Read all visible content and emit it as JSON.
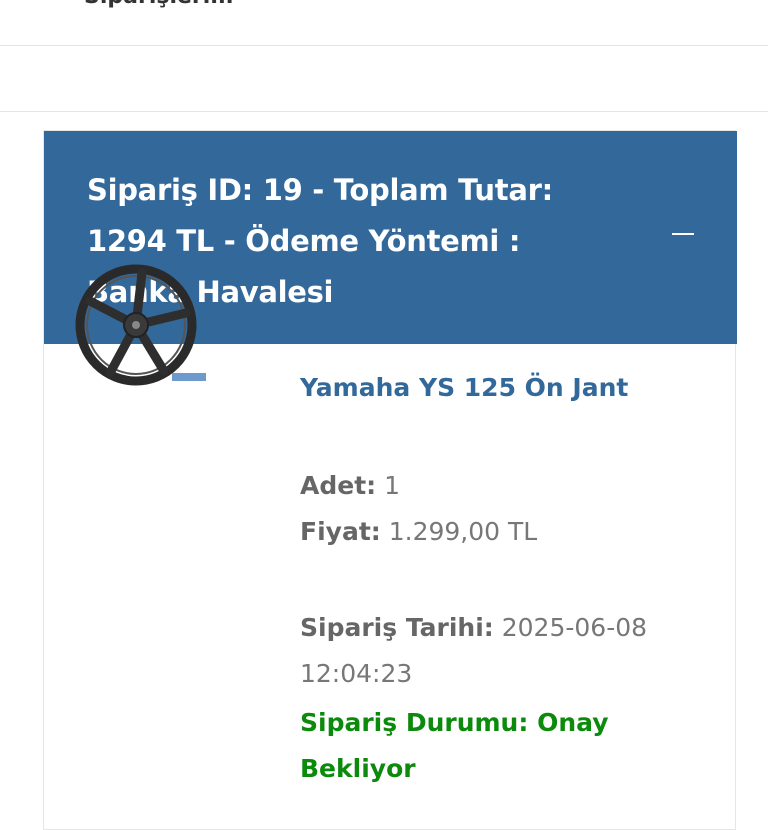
{
  "top_bar": {
    "cut_text": "Siparişlerim"
  },
  "order": {
    "header_title": "Sipariş ID: 19 - Toplam Tutar: 1294 TL - Ödeme Yöntemi : Banka Havalesi",
    "collapse_icon": "minus-icon"
  },
  "product": {
    "image_icon": "wheel-rim-image",
    "title": "Yamaha YS 125 Ön Jant",
    "quantity_label": "Adet:",
    "quantity_value": "1",
    "price_label": "Fiyat:",
    "price_value": "1.299,00 TL",
    "date_label": "Sipariş Tarihi:",
    "date_value": "2025-06-08 12:04:23",
    "status_label": "Sipariş Durumu:",
    "status_value": "Onay Bekliyor"
  },
  "colors": {
    "accent": "#33689a",
    "status_green": "#0c8a0c"
  }
}
